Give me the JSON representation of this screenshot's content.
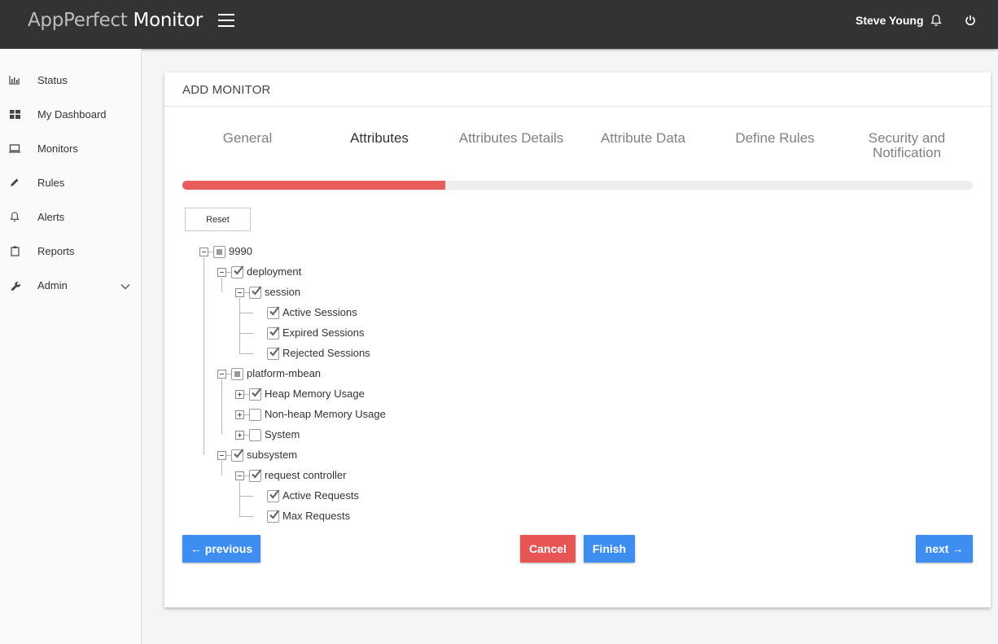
{
  "header": {
    "brand_light": "AppPerfect",
    "brand_strong": "Monitor",
    "user_name": "Steve Young",
    "icons": [
      "menu-icon",
      "bell-icon",
      "power-icon"
    ]
  },
  "sidebar": {
    "items": [
      {
        "label": "Status",
        "icon": "bar-chart-icon"
      },
      {
        "label": "My Dashboard",
        "icon": "dashboard-grid-icon"
      },
      {
        "label": "Monitors",
        "icon": "monitor-icon"
      },
      {
        "label": "Rules",
        "icon": "pencil-icon"
      },
      {
        "label": "Alerts",
        "icon": "bell-icon"
      },
      {
        "label": "Reports",
        "icon": "clipboard-icon"
      },
      {
        "label": "Admin",
        "icon": "wrench-icon",
        "expandable": true
      }
    ]
  },
  "main": {
    "title": "ADD MONITOR",
    "steps": [
      {
        "label": "General"
      },
      {
        "label": "Attributes"
      },
      {
        "label": "Attributes Details"
      },
      {
        "label": "Attribute Data"
      },
      {
        "label": "Define Rules"
      },
      {
        "label": "Security and Notification"
      }
    ],
    "active_step": 1,
    "progress_fraction": 0.333,
    "reset_label": "Reset",
    "tree": [
      {
        "label": "9990",
        "state": "partial",
        "expander": "minus"
      },
      {
        "label": "deployment",
        "state": "checked",
        "expander": "minus"
      },
      {
        "label": "session",
        "state": "checked",
        "expander": "minus"
      },
      {
        "label": "Active Sessions",
        "state": "checked"
      },
      {
        "label": "Expired Sessions",
        "state": "checked"
      },
      {
        "label": "Rejected Sessions",
        "state": "checked"
      },
      {
        "label": "platform-mbean",
        "state": "partial",
        "expander": "minus"
      },
      {
        "label": "Heap Memory Usage",
        "state": "checked",
        "expander": "plus"
      },
      {
        "label": "Non-heap Memory Usage",
        "state": "unchecked",
        "expander": "plus"
      },
      {
        "label": "System",
        "state": "unchecked",
        "expander": "plus"
      },
      {
        "label": "subsystem",
        "state": "checked",
        "expander": "minus"
      },
      {
        "label": "request controller",
        "state": "checked",
        "expander": "minus"
      },
      {
        "label": "Active Requests",
        "state": "checked"
      },
      {
        "label": "Max Requests",
        "state": "checked"
      }
    ],
    "buttons": {
      "previous": "← previous",
      "cancel": "Cancel",
      "finish": "Finish",
      "next": "next →"
    }
  },
  "colors": {
    "topbar": "#333333",
    "progress": "#e85c5c",
    "primary": "#3d8ef0",
    "danger": "#e85555"
  }
}
